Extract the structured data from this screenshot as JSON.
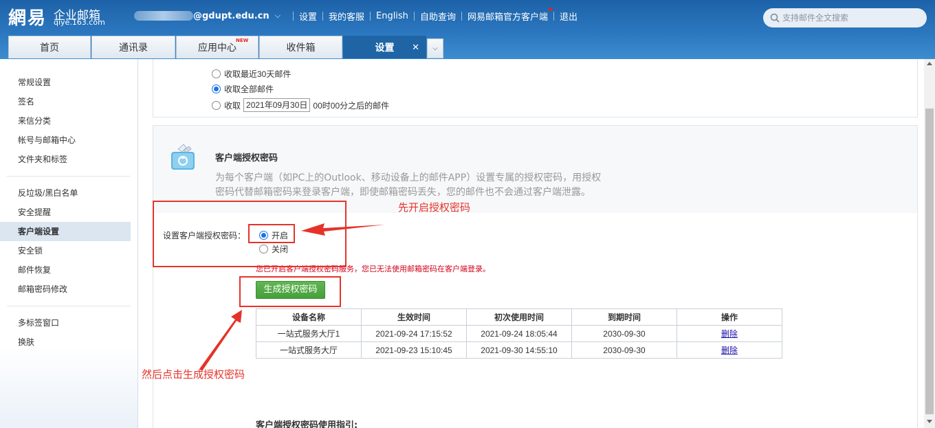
{
  "header": {
    "logo_cn": "網易",
    "logo_title": "企业邮箱",
    "logo_domain": "qiye.163.com",
    "account_domain": "@gdupt.edu.cn",
    "nav": [
      "设置",
      "我的客服",
      "English",
      "自助查询",
      "网易邮箱官方客户端",
      "退出"
    ],
    "search_placeholder": "支持邮件全文搜索"
  },
  "tabs": [
    {
      "label": "首页"
    },
    {
      "label": "通讯录"
    },
    {
      "label": "应用中心",
      "badge": "NEW"
    },
    {
      "label": "收件箱"
    },
    {
      "label": "设置",
      "active": true
    }
  ],
  "sidebar": {
    "group1": [
      "常规设置",
      "签名",
      "来信分类",
      "帐号与邮箱中心",
      "文件夹和标签"
    ],
    "group2": [
      "反垃圾/黑白名单",
      "安全提醒",
      "客户端设置",
      "安全锁",
      "邮件恢复",
      "邮箱密码修改"
    ],
    "group3": [
      "多标签窗口",
      "换肤"
    ],
    "active": "客户端设置"
  },
  "receive": {
    "opt1": "收取最近30天邮件",
    "opt2": "收取全部邮件",
    "opt3_prefix": "收取",
    "opt3_date": "2021年09月30日",
    "opt3_suffix": "00时00分之后的邮件",
    "selected": "opt2"
  },
  "auth": {
    "title": "客户端授权密码",
    "desc": "为每个客户端（如PC上的Outlook、移动设备上的邮件APP）设置专属的授权密码，用授权密码代替邮箱密码来登录客户端，即使邮箱密码丢失，您的邮件也不会通过客户端泄露。",
    "set_label": "设置客户端授权密码：",
    "on_label": "开启",
    "off_label": "关闭",
    "selected": "on",
    "warning": "您已开启客户端授权密码服务，您已无法使用邮箱密码在客户端登录。",
    "generate_button": "生成授权密码",
    "guide_title": "客户端授权密码使用指引:"
  },
  "device_table": {
    "headers": [
      "设备名称",
      "生效时间",
      "初次使用时间",
      "到期时间",
      "操作"
    ],
    "rows": [
      [
        "一站式服务大厅1",
        "2021-09-24 17:15:52",
        "2021-09-24 18:05:44",
        "2030-09-30",
        "删除"
      ],
      [
        "一站式服务大厅",
        "2021-09-23 15:10:45",
        "2021-09-30 14:55:10",
        "2030-09-30",
        "删除"
      ]
    ]
  },
  "annotations": {
    "step1": "先开启授权密码",
    "step2": "然后点击生成授权密码",
    "color": "#e5332a"
  },
  "colors": {
    "header_blue": "#2b77bf",
    "active_tab": "#1f65a6",
    "generate_green": "#45a03a",
    "warning_red": "#d0021b"
  }
}
